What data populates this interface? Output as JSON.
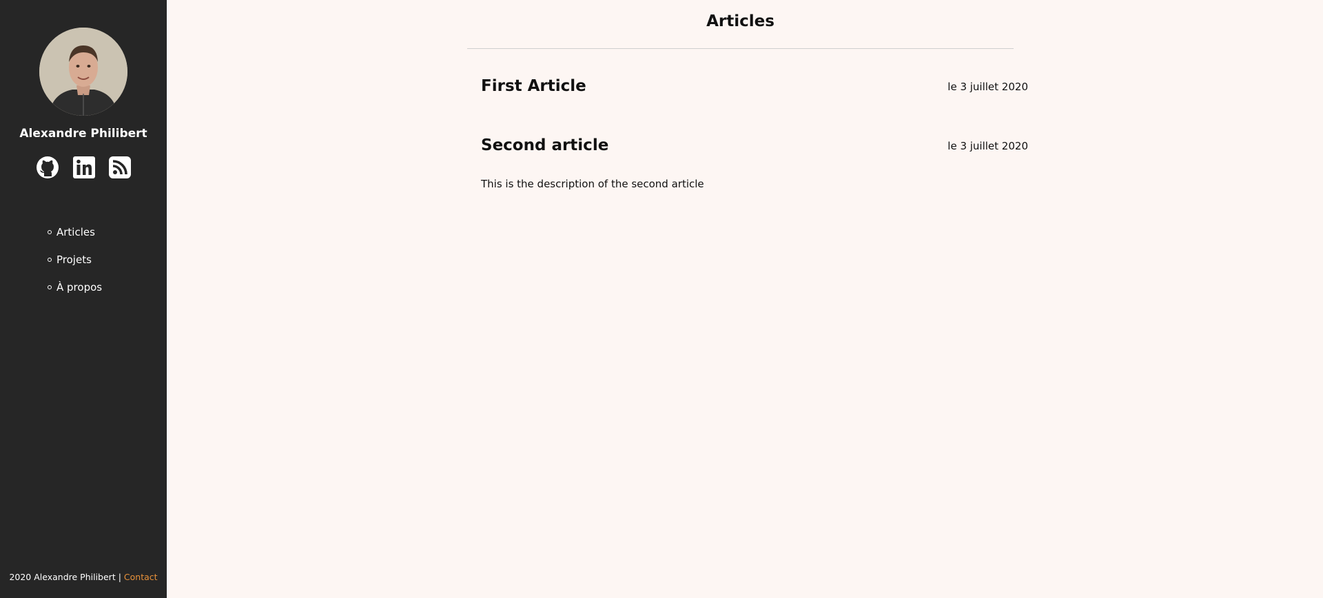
{
  "sidebar": {
    "author_name": "Alexandre Philibert",
    "socials": [
      {
        "icon": "github-icon"
      },
      {
        "icon": "linkedin-icon"
      },
      {
        "icon": "rss-icon"
      }
    ],
    "nav": [
      {
        "label": "Articles"
      },
      {
        "label": "Projets"
      },
      {
        "label": "À propos"
      }
    ],
    "footer": {
      "text": "2020 Alexandre Philibert | ",
      "contact_label": "Contact"
    }
  },
  "main": {
    "title": "Articles",
    "articles": [
      {
        "title": "First Article",
        "date": "le 3 juillet 2020",
        "description": ""
      },
      {
        "title": "Second article",
        "date": "le 3 juillet 2020",
        "description": "This is the description of the second article"
      }
    ]
  },
  "colors": {
    "sidebar_bg": "#262626",
    "page_bg": "#fdf6f3",
    "accent": "#e8913a"
  }
}
